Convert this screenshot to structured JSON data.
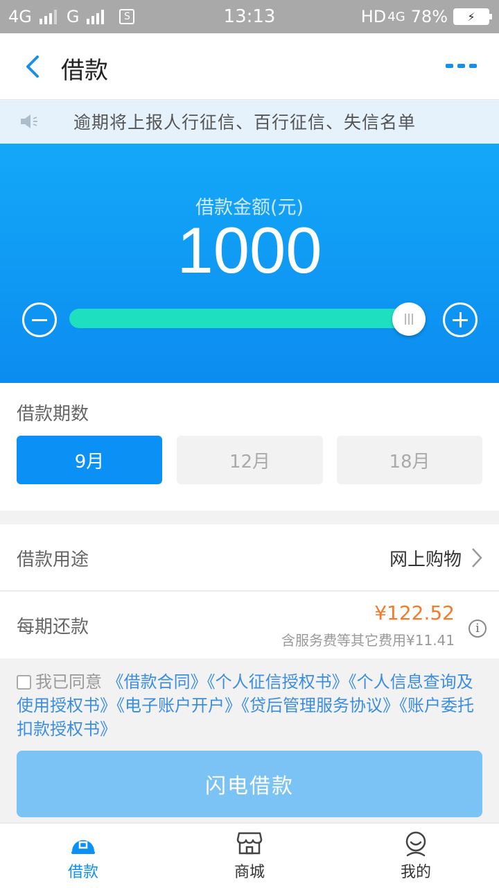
{
  "statusbar": {
    "net1": "4G",
    "net2": "G",
    "sim": "S",
    "time": "13:13",
    "hd": "HD",
    "net3": "4G",
    "battery": "78%"
  },
  "nav": {
    "title": "借款",
    "back_icon": "chevron-left-icon",
    "more_icon": "more-icon"
  },
  "notice": {
    "text": "逾期将上报人行征信、百行征信、失信名单",
    "icon": "speaker-icon"
  },
  "loan": {
    "amount_label": "借款金额(元)",
    "amount": "1000",
    "slider_fraction": 0.96
  },
  "term": {
    "label": "借款期数",
    "options": [
      "9月",
      "12月",
      "18月"
    ],
    "selected": "9月"
  },
  "purpose": {
    "label": "借款用途",
    "value": "网上购物"
  },
  "repay": {
    "label": "每期还款",
    "amount": "¥122.52",
    "fee": "含服务费等其它费用¥11.41",
    "info": "i"
  },
  "agreement": {
    "prefix": "我已同意",
    "links": [
      "《借款合同》",
      "《个人征信授权书》",
      "《个人信息查询及使用授权书》",
      "《电子账户开户》",
      "《贷后管理服务协议》",
      "《账户委托扣款授权书》"
    ]
  },
  "submit": {
    "label": "闪电借款"
  },
  "tabs": [
    {
      "label": "借款",
      "icon": "loan-icon"
    },
    {
      "label": "商城",
      "icon": "store-icon"
    },
    {
      "label": "我的",
      "icon": "profile-icon"
    }
  ],
  "colors": {
    "primary": "#0b90f5",
    "slider": "#1ee0c0",
    "price": "#f57a2a",
    "link": "#3a8de0"
  }
}
